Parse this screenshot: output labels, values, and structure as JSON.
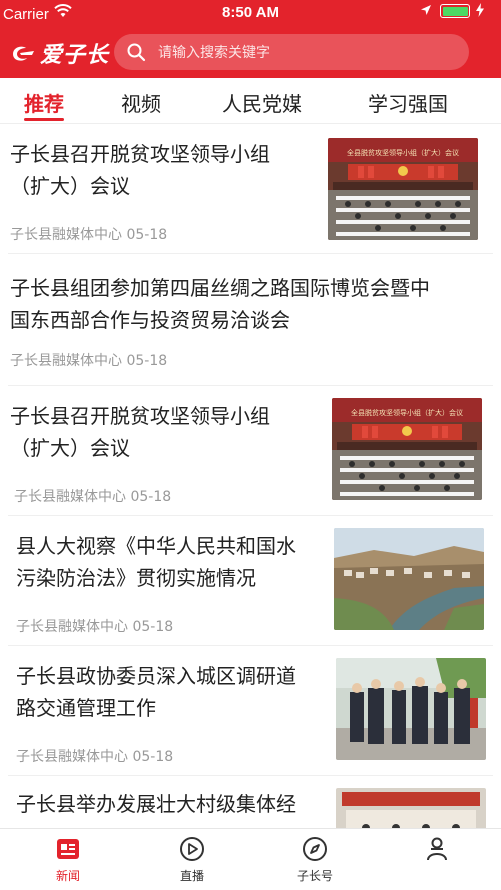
{
  "status_bar": {
    "carrier": "Carrier",
    "time": "8:50 AM"
  },
  "header": {
    "logo_text": "爱子长",
    "search_placeholder": "请输入搜索关键字"
  },
  "tabs": [
    {
      "label": "推荐",
      "active": true
    },
    {
      "label": "视频",
      "active": false
    },
    {
      "label": "人民党媒",
      "active": false
    },
    {
      "label": "学习强国",
      "active": false
    }
  ],
  "news": [
    {
      "title_line1": "子长县召开脱贫攻坚领导小组",
      "title_line2": "（扩大）会议",
      "source": "子长县融媒体中心",
      "date": "05-18",
      "thumb": "meeting-hall-photo",
      "thumb_caption": "全县脱贫攻坚领导小组（扩大）会议"
    },
    {
      "title_line1": "子长县组团参加第四届丝绸之路国际博览会暨中",
      "title_line2": "国东西部合作与投资贸易洽谈会",
      "source": "子长县融媒体中心",
      "date": "05-18"
    },
    {
      "title_line1": "子长县召开脱贫攻坚领导小组",
      "title_line2": "（扩大）会议",
      "source": "子长县融媒体中心",
      "date": "05-18",
      "thumb": "meeting-hall-photo",
      "thumb_caption": "全县脱贫攻坚领导小组（扩大）会议"
    },
    {
      "title_line1": "县人大视察《中华人民共和国水",
      "title_line2": "污染防治法》贯彻实施情况",
      "source": "子长县融媒体中心",
      "date": "05-18",
      "thumb": "river-town-photo"
    },
    {
      "title_line1": "子长县政协委员深入城区调研道",
      "title_line2": "路交通管理工作",
      "source": "子长县融媒体中心",
      "date": "05-18",
      "thumb": "officials-street-photo"
    },
    {
      "title_line1": "子长县举办发展壮大村级集体经",
      "title_line2": "",
      "source": "",
      "date": "",
      "thumb": "conference-photo"
    }
  ],
  "tabbar": [
    {
      "label": "新闻",
      "icon": "news-icon",
      "active": true
    },
    {
      "label": "直播",
      "icon": "play-icon",
      "active": false
    },
    {
      "label": "子长号",
      "icon": "compass-icon",
      "active": false
    },
    {
      "label": "",
      "icon": "user-icon",
      "active": false
    }
  ],
  "colors": {
    "brand_red": "#e3232c",
    "meta_gray": "#999999",
    "battery_green": "#4cd964"
  }
}
